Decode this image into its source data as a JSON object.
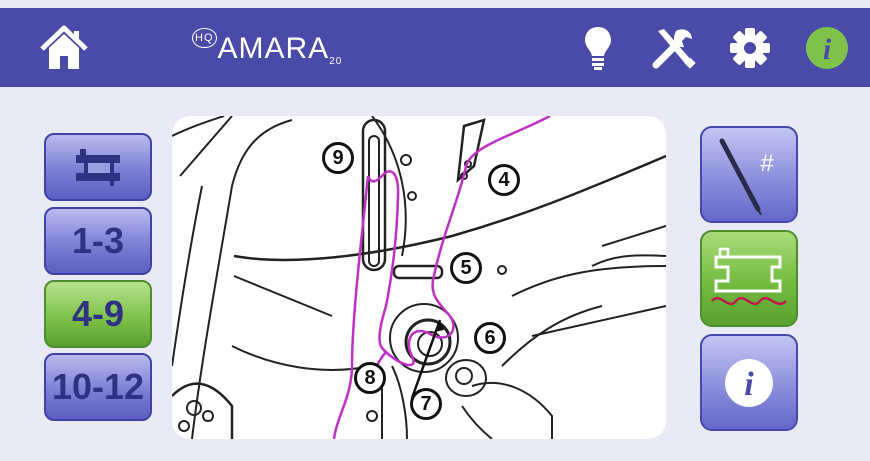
{
  "header": {
    "brand_prefix": "HQ",
    "brand_name": "AMARA",
    "brand_suffix": "20",
    "icons": [
      "home-icon",
      "lightbulb-icon",
      "tools-icon",
      "gear-icon",
      "info-icon"
    ],
    "info_icon_color": "#7fc24b"
  },
  "left_nav": {
    "items": [
      {
        "icon": "sewing-machine-icon",
        "label": ""
      },
      {
        "label": "1-3"
      },
      {
        "label": "4-9",
        "active": true
      },
      {
        "label": "10-12"
      }
    ]
  },
  "diagram": {
    "step_labels": [
      "9",
      "4",
      "5",
      "6",
      "7",
      "8"
    ],
    "thread_color": "#c030c8"
  },
  "right_nav": {
    "items": [
      {
        "icon": "needle-icon",
        "glyph": "#"
      },
      {
        "icon": "machine-stitch-icon",
        "active": true
      },
      {
        "icon": "info-icon",
        "glyph": "i"
      }
    ]
  },
  "colors": {
    "header_bg": "#4a4aa8",
    "page_bg": "#e9eaf5",
    "active_green": "#7fc24b"
  }
}
